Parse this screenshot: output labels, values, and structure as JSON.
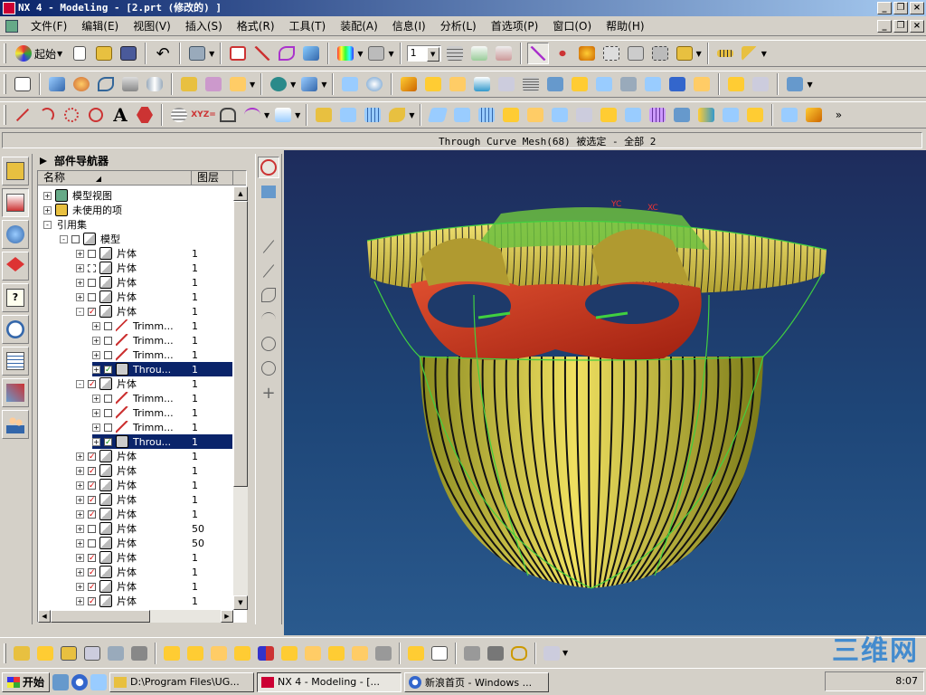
{
  "window": {
    "title": "NX 4 - Modeling - [2.prt (修改的) ]",
    "minimize": "_",
    "restore": "❐",
    "close": "×"
  },
  "menubar": {
    "items": [
      "文件(F)",
      "编辑(E)",
      "视图(V)",
      "插入(S)",
      "格式(R)",
      "工具(T)",
      "装配(A)",
      "信息(I)",
      "分析(L)",
      "首选项(P)",
      "窗口(O)",
      "帮助(H)"
    ]
  },
  "toolbar": {
    "start_label": "起始",
    "layer_combo_value": "1"
  },
  "cue_line": {
    "status": "Through Curve Mesh(68) 被选定 - 全部 2"
  },
  "navigator": {
    "title": "部件导航器",
    "col_name": "名称",
    "col_layer": "图层",
    "rows": [
      {
        "indent": 0,
        "exp": "+",
        "check": "",
        "icon": "view",
        "label": "模型视图",
        "layer": ""
      },
      {
        "indent": 0,
        "exp": "+",
        "check": "",
        "icon": "folder",
        "label": "未使用的项",
        "layer": ""
      },
      {
        "indent": 0,
        "exp": "-",
        "check": "",
        "icon": "",
        "label": "引用集",
        "layer": ""
      },
      {
        "indent": 1,
        "exp": "-",
        "check": "box",
        "icon": "model",
        "label": "模型",
        "layer": ""
      },
      {
        "indent": 2,
        "exp": "+",
        "check": "box",
        "icon": "body",
        "label": "片体",
        "layer": "1"
      },
      {
        "indent": 2,
        "exp": "+",
        "check": "dash",
        "icon": "body",
        "label": "片体",
        "layer": "1"
      },
      {
        "indent": 2,
        "exp": "+",
        "check": "box",
        "icon": "body",
        "label": "片体",
        "layer": "1"
      },
      {
        "indent": 2,
        "exp": "+",
        "check": "box",
        "icon": "body",
        "label": "片体",
        "layer": "1"
      },
      {
        "indent": 2,
        "exp": "-",
        "check": "red",
        "icon": "body",
        "label": "片体",
        "layer": "1"
      },
      {
        "indent": 3,
        "exp": "+",
        "check": "box",
        "icon": "trim",
        "label": "Trimm...",
        "layer": "1"
      },
      {
        "indent": 3,
        "exp": "+",
        "check": "box",
        "icon": "trim",
        "label": "Trimm...",
        "layer": "1"
      },
      {
        "indent": 3,
        "exp": "+",
        "check": "box",
        "icon": "trim",
        "label": "Trimm...",
        "layer": "1"
      },
      {
        "indent": 3,
        "exp": "+",
        "check": "green",
        "icon": "mesh",
        "label": "Throu...",
        "layer": "1",
        "selected": true
      },
      {
        "indent": 2,
        "exp": "-",
        "check": "red",
        "icon": "body",
        "label": "片体",
        "layer": "1"
      },
      {
        "indent": 3,
        "exp": "+",
        "check": "box",
        "icon": "trim",
        "label": "Trimm...",
        "layer": "1"
      },
      {
        "indent": 3,
        "exp": "+",
        "check": "box",
        "icon": "trim",
        "label": "Trimm...",
        "layer": "1"
      },
      {
        "indent": 3,
        "exp": "+",
        "check": "box",
        "icon": "trim",
        "label": "Trimm...",
        "layer": "1"
      },
      {
        "indent": 3,
        "exp": "+",
        "check": "green",
        "icon": "mesh",
        "label": "Throu...",
        "layer": "1",
        "selected": true
      },
      {
        "indent": 2,
        "exp": "+",
        "check": "red",
        "icon": "body",
        "label": "片体",
        "layer": "1"
      },
      {
        "indent": 2,
        "exp": "+",
        "check": "red",
        "icon": "body",
        "label": "片体",
        "layer": "1"
      },
      {
        "indent": 2,
        "exp": "+",
        "check": "red",
        "icon": "body",
        "label": "片体",
        "layer": "1"
      },
      {
        "indent": 2,
        "exp": "+",
        "check": "red",
        "icon": "body",
        "label": "片体",
        "layer": "1"
      },
      {
        "indent": 2,
        "exp": "+",
        "check": "red",
        "icon": "body",
        "label": "片体",
        "layer": "1"
      },
      {
        "indent": 2,
        "exp": "+",
        "check": "box",
        "icon": "body",
        "label": "片体",
        "layer": "50"
      },
      {
        "indent": 2,
        "exp": "+",
        "check": "box",
        "icon": "body",
        "label": "片体",
        "layer": "50"
      },
      {
        "indent": 2,
        "exp": "+",
        "check": "red",
        "icon": "body",
        "label": "片体",
        "layer": "1"
      },
      {
        "indent": 2,
        "exp": "+",
        "check": "red",
        "icon": "body",
        "label": "片体",
        "layer": "1"
      },
      {
        "indent": 2,
        "exp": "+",
        "check": "red",
        "icon": "body",
        "label": "片体",
        "layer": "1"
      },
      {
        "indent": 2,
        "exp": "+",
        "check": "red",
        "icon": "body",
        "label": "片体",
        "layer": "1"
      }
    ]
  },
  "viewport": {
    "axis_label_1": "YC",
    "axis_label_2": "XC"
  },
  "taskbar": {
    "start": "开始",
    "tasks": [
      {
        "label": "D:\\Program Files\\UG...",
        "active": false
      },
      {
        "label": "NX 4 - Modeling - [...",
        "active": true
      },
      {
        "label": "新浪首页 - Windows ...",
        "active": false
      }
    ],
    "clock": "8:07"
  },
  "watermark": "三维网"
}
